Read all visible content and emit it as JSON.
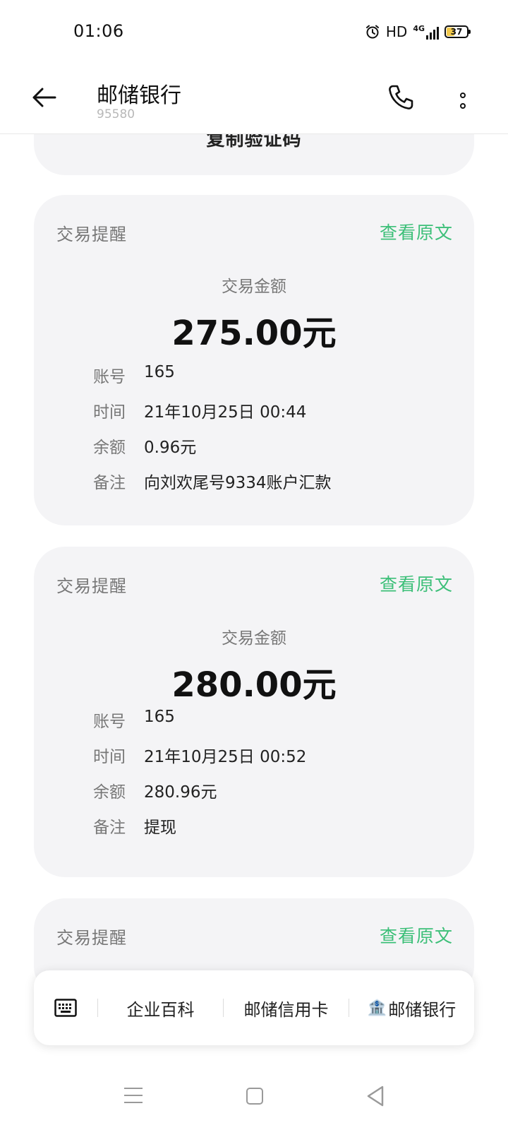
{
  "status_bar": {
    "time": "01:06",
    "hd": "HD",
    "network": "4G",
    "battery": "37",
    "battery_level": 0.37
  },
  "header": {
    "title": "邮储银行",
    "subtitle": "95580"
  },
  "top_card": {
    "copy_label": "复制验证码"
  },
  "messages": [
    {
      "label": "交易提醒",
      "link": "查看原文",
      "amount_label": "交易金额",
      "amount": "275.00元",
      "rows": [
        {
          "key": "账号",
          "value": "165"
        },
        {
          "key": "时间",
          "value": "21年10月25日 00:44"
        },
        {
          "key": "余额",
          "value": "0.96元"
        },
        {
          "key": "备注",
          "value": "向刘欢尾号9334账户汇款"
        }
      ]
    },
    {
      "label": "交易提醒",
      "link": "查看原文",
      "amount_label": "交易金额",
      "amount": "280.00元",
      "rows": [
        {
          "key": "账号",
          "value": "165"
        },
        {
          "key": "时间",
          "value": "21年10月25日 00:52"
        },
        {
          "key": "余额",
          "value": "280.96元"
        },
        {
          "key": "备注",
          "value": "提现"
        }
      ]
    },
    {
      "label": "交易提醒",
      "link": "查看原文"
    }
  ],
  "quick_bar": {
    "items": [
      "企业百科",
      "邮储信用卡",
      "邮储银行"
    ]
  },
  "colors": {
    "accent": "#3cbf78",
    "card_bg": "#f4f4f6"
  }
}
